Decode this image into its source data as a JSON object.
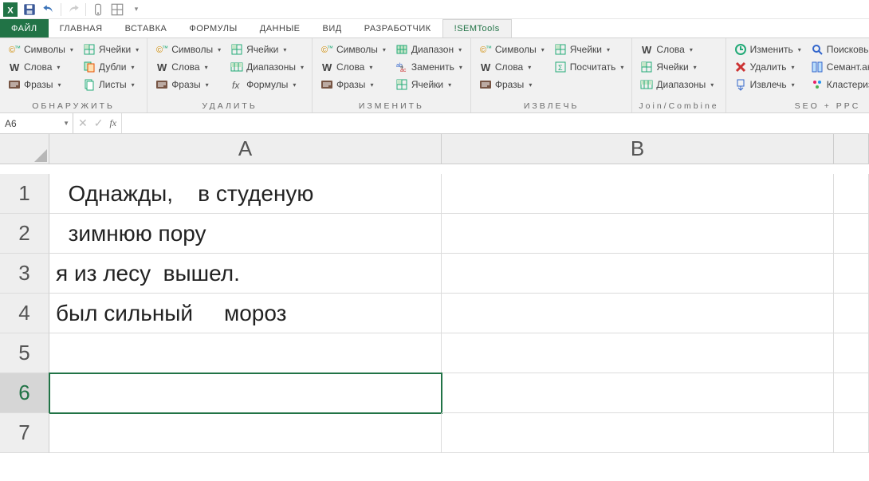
{
  "qat": {
    "items": [
      "excel-icon",
      "save-icon",
      "undo-icon",
      "redo-icon",
      "touch-icon",
      "borders-icon",
      "more-icon"
    ]
  },
  "tabs": {
    "file": "ФАЙЛ",
    "items": [
      "ГЛАВНАЯ",
      "ВСТАВКА",
      "ФОРМУЛЫ",
      "ДАННЫЕ",
      "ВИД",
      "РАЗРАБОТЧИК",
      "!SEMTools"
    ],
    "active_index": 6
  },
  "ribbon": {
    "groups": [
      {
        "label": "ОБНАРУЖИТЬ",
        "cols": [
          [
            {
              "icon": "symbols",
              "text": "Символы"
            },
            {
              "icon": "w",
              "text": "Слова"
            },
            {
              "icon": "phrases",
              "text": "Фразы"
            }
          ],
          [
            {
              "icon": "cells",
              "text": "Ячейки"
            },
            {
              "icon": "dupes",
              "text": "Дубли"
            },
            {
              "icon": "sheets",
              "text": "Листы"
            }
          ]
        ]
      },
      {
        "label": "УДАЛИТЬ",
        "cols": [
          [
            {
              "icon": "symbols",
              "text": "Символы"
            },
            {
              "icon": "w",
              "text": "Слова"
            },
            {
              "icon": "phrases",
              "text": "Фразы"
            }
          ],
          [
            {
              "icon": "cells",
              "text": "Ячейки"
            },
            {
              "icon": "ranges",
              "text": "Диапазоны"
            },
            {
              "icon": "fx",
              "text": "Формулы"
            }
          ]
        ]
      },
      {
        "label": "ИЗМЕНИТЬ",
        "cols": [
          [
            {
              "icon": "symbols",
              "text": "Символы"
            },
            {
              "icon": "w",
              "text": "Слова"
            },
            {
              "icon": "phrases",
              "text": "Фразы"
            }
          ],
          [
            {
              "icon": "range",
              "text": "Диапазон"
            },
            {
              "icon": "replace",
              "text": "Заменить"
            },
            {
              "icon": "cells",
              "text": "Ячейки"
            }
          ]
        ]
      },
      {
        "label": "ИЗВЛЕЧЬ",
        "cols": [
          [
            {
              "icon": "symbols",
              "text": "Символы"
            },
            {
              "icon": "w",
              "text": "Слова"
            },
            {
              "icon": "phrases",
              "text": "Фразы"
            }
          ],
          [
            {
              "icon": "cells",
              "text": "Ячейки"
            },
            {
              "icon": "count",
              "text": "Посчитать"
            }
          ]
        ]
      },
      {
        "label": "Join/Combine",
        "cols": [
          [
            {
              "icon": "w",
              "text": "Слова"
            },
            {
              "icon": "cells",
              "text": "Ячейки"
            },
            {
              "icon": "ranges",
              "text": "Диапазоны"
            }
          ]
        ]
      },
      {
        "label": "SEO + PPC",
        "cols": [
          [
            {
              "icon": "edit",
              "text": "Изменить"
            },
            {
              "icon": "delete",
              "text": "Удалить"
            },
            {
              "icon": "extract",
              "text": "Извлечь"
            }
          ],
          [
            {
              "icon": "search",
              "text": "Поисковые подсказ"
            },
            {
              "icon": "semant",
              "text": "Семант.анализ"
            },
            {
              "icon": "cluster",
              "text": "Кластеризация"
            }
          ]
        ]
      }
    ]
  },
  "formula_bar": {
    "namebox": "A6",
    "fx_label": "fx",
    "value": ""
  },
  "grid": {
    "columns": [
      "A",
      "B"
    ],
    "row_count": 7,
    "selected_row": 6,
    "selected_cell": "A6",
    "rows": [
      {
        "A": "  Однажды,    в студеную",
        "B": ""
      },
      {
        "A": "  зимнюю пору",
        "B": ""
      },
      {
        "A": "я из лесу  вышел.",
        "B": ""
      },
      {
        "A": "был сильный     мороз",
        "B": ""
      },
      {
        "A": "",
        "B": ""
      },
      {
        "A": "",
        "B": ""
      },
      {
        "A": "",
        "B": ""
      }
    ]
  }
}
